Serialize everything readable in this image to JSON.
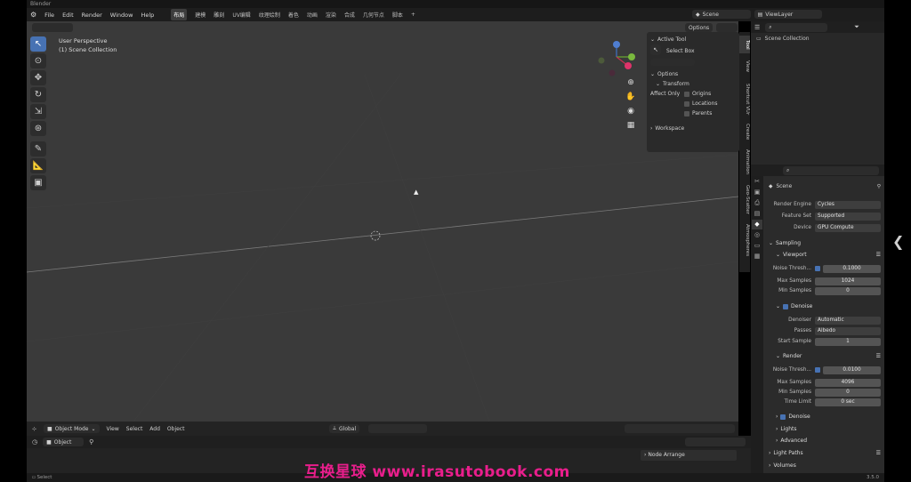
{
  "window": {
    "title": "Blender"
  },
  "menu": [
    "File",
    "Edit",
    "Render",
    "Window",
    "Help"
  ],
  "workspaces": [
    "布局",
    "建模",
    "雕刻",
    "UV编辑",
    "纹理绘制",
    "着色",
    "动画",
    "渲染",
    "合成",
    "几何节点",
    "脚本"
  ],
  "active_workspace": "布局",
  "header_right": {
    "scene": "Scene",
    "view_layer": "ViewLayer"
  },
  "viewport": {
    "perspective": "User Perspective",
    "collection": "(1) Scene Collection",
    "options_label": "Options"
  },
  "npanel": {
    "active_tool_label": "Active Tool",
    "tool_name": "Select Box",
    "options_label": "Options",
    "transform_label": "Transform",
    "affect_only_label": "Affect Only",
    "origins": "Origins",
    "locations": "Locations",
    "parents": "Parents",
    "workspace_label": "Workspace"
  },
  "vtabs": [
    "Tool",
    "View",
    "Shortcut VUr",
    "Create",
    "Animation",
    "Geo-Scatter",
    "Atmospheres"
  ],
  "bottom_bar": {
    "mode": "Object Mode",
    "items": [
      "View",
      "Select",
      "Add",
      "Object"
    ],
    "orientation": "Global"
  },
  "timeline": {
    "editor": "Object"
  },
  "node_arrange": "Node Arrange",
  "outliner": {
    "root": "Scene Collection"
  },
  "properties": {
    "scene": "Scene",
    "render_engine_label": "Render Engine",
    "render_engine": "Cycles",
    "feature_set_label": "Feature Set",
    "feature_set": "Supported",
    "device_label": "Device",
    "device": "GPU Compute",
    "sampling": "Sampling",
    "viewport": "Viewport",
    "noise_threshold_label": "Noise Thresh...",
    "vp_noise": "0.1000",
    "max_samples_label": "Max Samples",
    "vp_max": "1024",
    "min_samples_label": "Min Samples",
    "vp_min": "0",
    "denoise": "Denoise",
    "denoiser_label": "Denoiser",
    "denoiser": "Automatic",
    "passes_label": "Passes",
    "passes": "Albedo",
    "start_sample_label": "Start Sample",
    "start_sample": "1",
    "render": "Render",
    "r_noise": "0.0100",
    "r_max": "4096",
    "r_min": "0",
    "time_limit_label": "Time Limit",
    "time_limit": "0 sec",
    "r_denoise": "Denoise",
    "lights": "Lights",
    "advanced": "Advanced",
    "light_paths": "Light Paths",
    "volumes": "Volumes"
  },
  "status": {
    "select": "Select",
    "version": "3.5.0"
  },
  "watermark": "互换星球 www.irasutobook.com"
}
